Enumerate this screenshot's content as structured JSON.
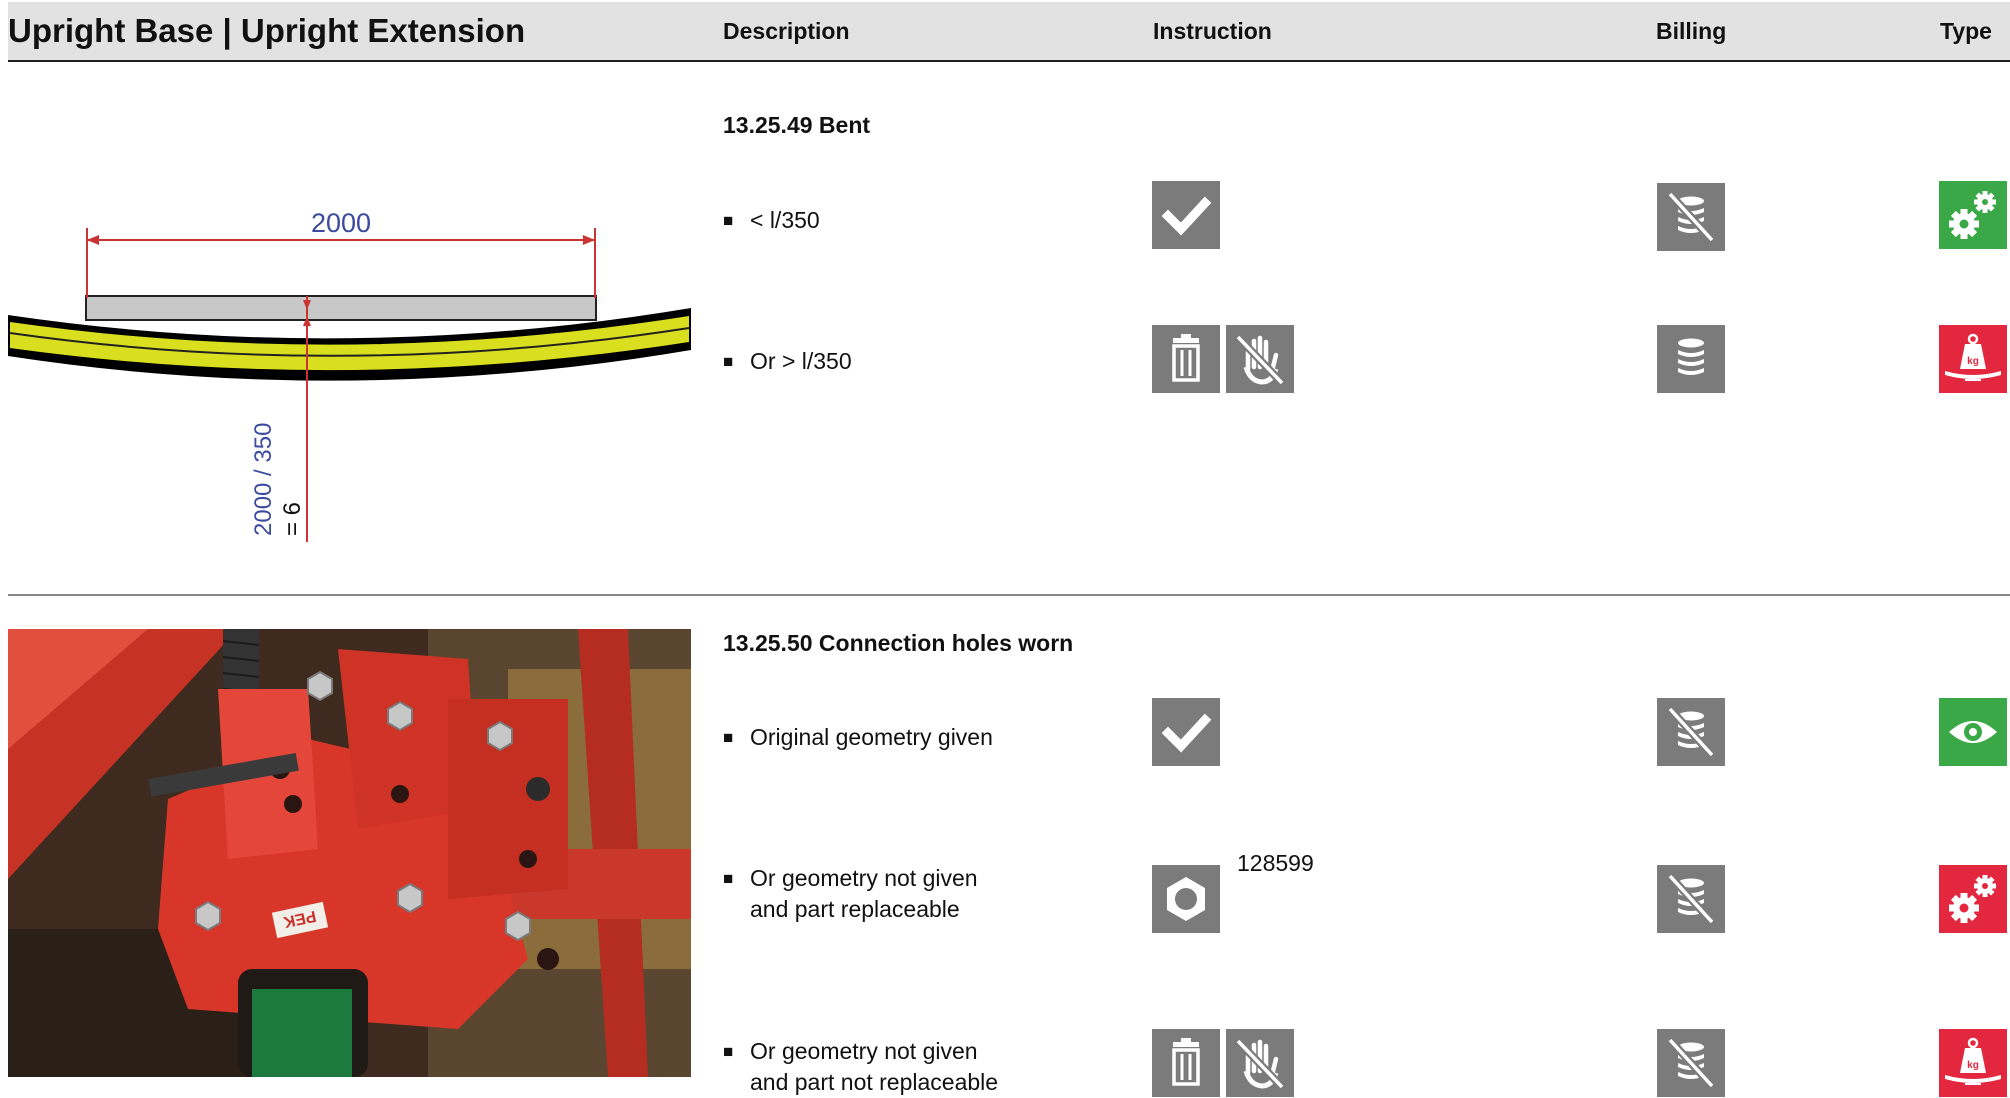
{
  "header": {
    "title": "Upright Base | Upright Extension",
    "description": "Description",
    "instruction": "Instruction",
    "billing": "Billing",
    "type": "Type"
  },
  "sections": [
    {
      "title": "13.25.49 Bent",
      "drawing": {
        "length_label": "2000",
        "deflection_label": "2000 / 350",
        "result_label": "= 6"
      },
      "options": [
        {
          "bullet": "■",
          "text": "< l/350",
          "instruction_icons": [
            "check-icon"
          ],
          "billing_icon": "no-billing-icon",
          "type_icon": "gears-icon"
        },
        {
          "bullet": "■",
          "text": "Or  > l/350",
          "instruction_icons": [
            "trash-icon",
            "no-hand-icon"
          ],
          "billing_icon": "billing-icon",
          "type_icon": "weight-kg-icon"
        }
      ]
    },
    {
      "title": "13.25.50 Connection holes worn",
      "photo": {
        "sticker_text": "PEK"
      },
      "options": [
        {
          "bullet": "■",
          "text": "Original geometry given",
          "instruction_icons": [
            "check-icon"
          ],
          "billing_icon": "no-billing-icon",
          "type_icon": "eye-icon"
        },
        {
          "bullet": "■",
          "text": "Or geometry not given",
          "text2": "and part replaceable",
          "instruction_icons": [
            "nut-icon"
          ],
          "part_number": "128599",
          "billing_icon": "no-billing-icon",
          "type_icon": "gears-icon"
        },
        {
          "bullet": "■",
          "text": "Or geometry not given",
          "text2": "and part not replaceable",
          "instruction_icons": [
            "trash-icon",
            "no-hand-icon"
          ],
          "billing_icon": "no-billing-icon",
          "type_icon": "weight-kg-icon"
        }
      ]
    }
  ],
  "colors": {
    "header_bg": "#e2e2e2",
    "icon_grey": "#7b7b7b",
    "type_green": "#3aa847",
    "type_red": "#e3273f",
    "frame_red": "#d9362a"
  }
}
